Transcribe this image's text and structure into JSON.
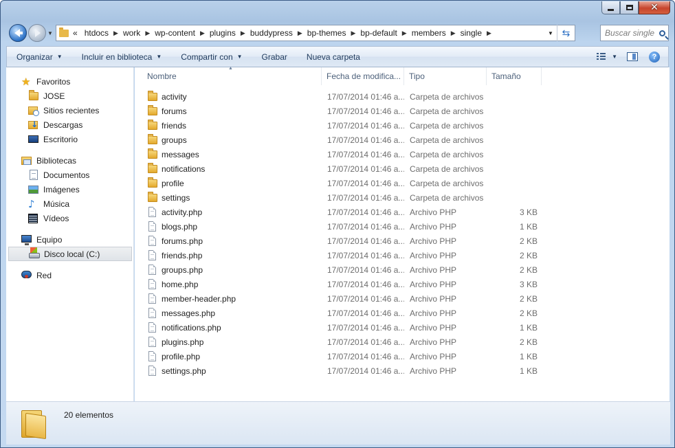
{
  "window": {
    "controls": {
      "minimize": "",
      "maximize": "",
      "close": "✕"
    }
  },
  "address": {
    "overflow": "«",
    "crumbs": [
      "htdocs",
      "work",
      "wp-content",
      "plugins",
      "buddypress",
      "bp-themes",
      "bp-default",
      "members",
      "single"
    ],
    "separator": "▶"
  },
  "search": {
    "placeholder": "Buscar single"
  },
  "toolbar": {
    "organize": "Organizar",
    "include_library": "Incluir en biblioteca",
    "share": "Compartir con",
    "burn": "Grabar",
    "new_folder": "Nueva carpeta",
    "help": "?"
  },
  "nav": {
    "favorites": {
      "label": "Favoritos",
      "items": [
        "JOSE",
        "Sitios recientes",
        "Descargas",
        "Escritorio"
      ]
    },
    "libraries": {
      "label": "Bibliotecas",
      "items": [
        "Documentos",
        "Imágenes",
        "Música",
        "Vídeos"
      ]
    },
    "computer": {
      "label": "Equipo",
      "items": [
        "Disco local (C:)"
      ]
    },
    "network": {
      "label": "Red"
    }
  },
  "columns": {
    "name": "Nombre",
    "date": "Fecha de modifica...",
    "type": "Tipo",
    "size": "Tamaño"
  },
  "files": [
    {
      "name": "activity",
      "date": "17/07/2014 01:46 a...",
      "type": "Carpeta de archivos",
      "size": "",
      "kind": "folder"
    },
    {
      "name": "forums",
      "date": "17/07/2014 01:46 a...",
      "type": "Carpeta de archivos",
      "size": "",
      "kind": "folder"
    },
    {
      "name": "friends",
      "date": "17/07/2014 01:46 a...",
      "type": "Carpeta de archivos",
      "size": "",
      "kind": "folder"
    },
    {
      "name": "groups",
      "date": "17/07/2014 01:46 a...",
      "type": "Carpeta de archivos",
      "size": "",
      "kind": "folder"
    },
    {
      "name": "messages",
      "date": "17/07/2014 01:46 a...",
      "type": "Carpeta de archivos",
      "size": "",
      "kind": "folder"
    },
    {
      "name": "notifications",
      "date": "17/07/2014 01:46 a...",
      "type": "Carpeta de archivos",
      "size": "",
      "kind": "folder"
    },
    {
      "name": "profile",
      "date": "17/07/2014 01:46 a...",
      "type": "Carpeta de archivos",
      "size": "",
      "kind": "folder"
    },
    {
      "name": "settings",
      "date": "17/07/2014 01:46 a...",
      "type": "Carpeta de archivos",
      "size": "",
      "kind": "folder"
    },
    {
      "name": "activity.php",
      "date": "17/07/2014 01:46 a...",
      "type": "Archivo PHP",
      "size": "3 KB",
      "kind": "php"
    },
    {
      "name": "blogs.php",
      "date": "17/07/2014 01:46 a...",
      "type": "Archivo PHP",
      "size": "1 KB",
      "kind": "php"
    },
    {
      "name": "forums.php",
      "date": "17/07/2014 01:46 a...",
      "type": "Archivo PHP",
      "size": "2 KB",
      "kind": "php"
    },
    {
      "name": "friends.php",
      "date": "17/07/2014 01:46 a...",
      "type": "Archivo PHP",
      "size": "2 KB",
      "kind": "php"
    },
    {
      "name": "groups.php",
      "date": "17/07/2014 01:46 a...",
      "type": "Archivo PHP",
      "size": "2 KB",
      "kind": "php"
    },
    {
      "name": "home.php",
      "date": "17/07/2014 01:46 a...",
      "type": "Archivo PHP",
      "size": "3 KB",
      "kind": "php"
    },
    {
      "name": "member-header.php",
      "date": "17/07/2014 01:46 a...",
      "type": "Archivo PHP",
      "size": "2 KB",
      "kind": "php"
    },
    {
      "name": "messages.php",
      "date": "17/07/2014 01:46 a...",
      "type": "Archivo PHP",
      "size": "2 KB",
      "kind": "php"
    },
    {
      "name": "notifications.php",
      "date": "17/07/2014 01:46 a...",
      "type": "Archivo PHP",
      "size": "1 KB",
      "kind": "php"
    },
    {
      "name": "plugins.php",
      "date": "17/07/2014 01:46 a...",
      "type": "Archivo PHP",
      "size": "2 KB",
      "kind": "php"
    },
    {
      "name": "profile.php",
      "date": "17/07/2014 01:46 a...",
      "type": "Archivo PHP",
      "size": "1 KB",
      "kind": "php"
    },
    {
      "name": "settings.php",
      "date": "17/07/2014 01:46 a...",
      "type": "Archivo PHP",
      "size": "1 KB",
      "kind": "php"
    }
  ],
  "details": {
    "count": "20 elementos"
  }
}
